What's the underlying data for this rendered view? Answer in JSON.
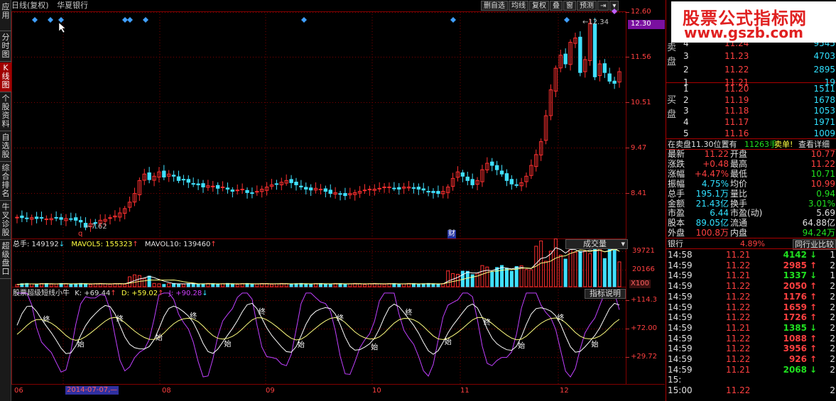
{
  "sidebar": {
    "tabs": [
      {
        "label": "应用"
      },
      {
        "label": "分时图"
      },
      {
        "label": "K线图"
      },
      {
        "label": "个股资料"
      },
      {
        "label": "自选股"
      },
      {
        "label": "综合排名"
      },
      {
        "label": "牛叉诊股"
      },
      {
        "label": "超级盘口"
      }
    ]
  },
  "header": {
    "period": "日线(复权)",
    "stock_name": "华夏银行"
  },
  "toolbar": {
    "buttons": [
      "删自选",
      "均线",
      "复权",
      "叠",
      "窗",
      "预测"
    ]
  },
  "price_axis": {
    "ticks": [
      "12.60",
      "12.30",
      "11.56",
      "10.51",
      "9.47",
      "8.41"
    ],
    "current": "12.30"
  },
  "annotations": {
    "high": "12.34",
    "low": "7.62",
    "low_marker": "q",
    "fin_marker": "财"
  },
  "volume_panel": {
    "label": "总手: 149192",
    "mavol5": "MAVOL5: 155323",
    "mavol10": "MAVOL10: 139460",
    "selector": "成交量",
    "ticks": [
      "39721",
      "20166",
      "X100"
    ]
  },
  "indicator_panel": {
    "label": "股票超级短线小牛",
    "k": "K: +69.44",
    "d": "D: +59.02",
    "j": "J: +90.28",
    "button": "指标说明",
    "ticks": [
      "+114.3",
      "+72.00",
      "+29.72"
    ],
    "start_mark": "始",
    "end_mark": "终"
  },
  "xaxis": {
    "labels": [
      "06",
      "08",
      "09",
      "10",
      "11",
      "12"
    ],
    "cursor_date": "2014-07-07,—"
  },
  "logo": {
    "line1": "股票公式指标网",
    "line2": "www.gszb.com"
  },
  "orderbook": {
    "sell_label": "卖盘",
    "buy_label": "买盘",
    "sell": [
      {
        "n": "4",
        "price": "11.24",
        "vol": "9545"
      },
      {
        "n": "3",
        "price": "11.23",
        "vol": "4703"
      },
      {
        "n": "2",
        "price": "11.22",
        "vol": "2895"
      },
      {
        "n": "1",
        "price": "11.21",
        "vol": "19"
      }
    ],
    "buy": [
      {
        "n": "1",
        "price": "11.20",
        "vol": "1511"
      },
      {
        "n": "2",
        "price": "11.19",
        "vol": "1678"
      },
      {
        "n": "3",
        "price": "11.18",
        "vol": "1053"
      },
      {
        "n": "4",
        "price": "11.17",
        "vol": "1971"
      },
      {
        "n": "5",
        "price": "11.16",
        "vol": "1009"
      }
    ],
    "pending_prefix": "在卖盘11.30位置有",
    "pending_vol": "11263手",
    "pending_tag": "卖单!",
    "detail_link": "查看详细"
  },
  "stats": [
    {
      "l": "最新",
      "v": "11.22",
      "l2": "开盘",
      "v2": "10.77"
    },
    {
      "l": "涨跌",
      "v": "+0.48",
      "l2": "最高",
      "v2": "11.22"
    },
    {
      "l": "涨幅",
      "v": "+4.47%",
      "l2": "最低",
      "v2": "10.71"
    },
    {
      "l": "振幅",
      "v": "4.75%",
      "l2": "均价",
      "v2": "10.99"
    },
    {
      "l": "总手",
      "v": "195.1万",
      "l2": "量比",
      "v2": "0.94"
    },
    {
      "l": "金额",
      "v": "21.43亿",
      "l2": "换手",
      "v2": "3.01%"
    },
    {
      "l": "市盈",
      "v": "6.44",
      "l2": "市盈(动)",
      "v2": "5.69"
    },
    {
      "l": "股本",
      "v": "89.05亿",
      "l2": "流通",
      "v2": "64.88亿"
    },
    {
      "l": "外盘",
      "v": "100.8万",
      "l2": "内盘",
      "v2": "94.24万"
    }
  ],
  "industry": {
    "name": "银行",
    "pct": "4.89%",
    "compare": "同行业比较"
  },
  "ticks": [
    {
      "t": "14:58",
      "p": "11.21",
      "v": "4142",
      "d": "down",
      "x": "1"
    },
    {
      "t": "14:59",
      "p": "11.22",
      "v": "2985",
      "d": "up",
      "x": "2"
    },
    {
      "t": "14:59",
      "p": "11.21",
      "v": "1337",
      "d": "down",
      "x": "1"
    },
    {
      "t": "14:59",
      "p": "11.22",
      "v": "2050",
      "d": "up",
      "x": "2"
    },
    {
      "t": "14:59",
      "p": "11.22",
      "v": "1176",
      "d": "up",
      "x": "2"
    },
    {
      "t": "14:59",
      "p": "11.22",
      "v": "1659",
      "d": "up",
      "x": "2"
    },
    {
      "t": "14:59",
      "p": "11.22",
      "v": "1726",
      "d": "up",
      "x": "2"
    },
    {
      "t": "14:59",
      "p": "11.21",
      "v": "1385",
      "d": "down",
      "x": "2"
    },
    {
      "t": "14:59",
      "p": "11.22",
      "v": "1088",
      "d": "up",
      "x": "2"
    },
    {
      "t": "14:59",
      "p": "11.22",
      "v": "3956",
      "d": "up",
      "x": "2"
    },
    {
      "t": "14:59",
      "p": "11.22",
      "v": "926",
      "d": "up",
      "x": "2"
    },
    {
      "t": "14:59",
      "p": "11.21",
      "v": "2068",
      "d": "down",
      "x": "2"
    },
    {
      "t": "15:",
      "p": "",
      "v": "",
      "d": "",
      "x": ""
    },
    {
      "t": "15:00",
      "p": "11.22",
      "v": "",
      "d": "",
      "x": "2"
    }
  ],
  "colors": {
    "up": "#ff3030",
    "down": "#40e0ff",
    "ma_white": "#ffffff",
    "ma_yellow": "#ffff80",
    "j_line": "#c040ff",
    "grid": "#800000",
    "diamond": "#40a0ff"
  }
}
